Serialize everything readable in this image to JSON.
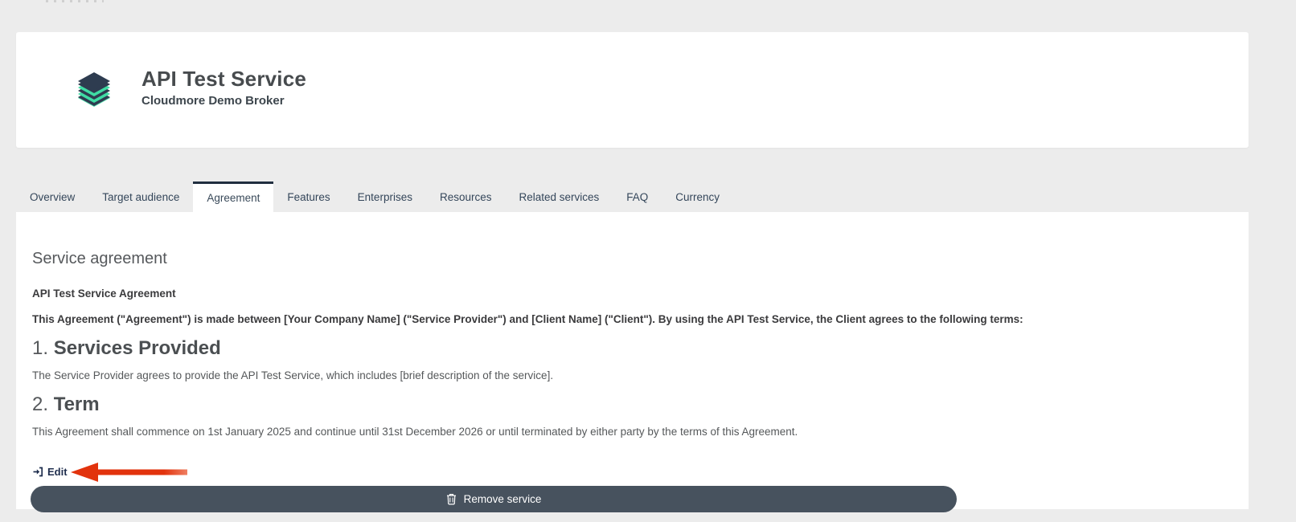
{
  "header": {
    "title": "API Test Service",
    "subtitle": "Cloudmore Demo Broker",
    "icon": "layers-stack-icon"
  },
  "tabs": [
    {
      "label": "Overview",
      "active": false
    },
    {
      "label": "Target audience",
      "active": false
    },
    {
      "label": "Agreement",
      "active": true
    },
    {
      "label": "Features",
      "active": false
    },
    {
      "label": "Enterprises",
      "active": false
    },
    {
      "label": "Resources",
      "active": false
    },
    {
      "label": "Related services",
      "active": false
    },
    {
      "label": "FAQ",
      "active": false
    },
    {
      "label": "Currency",
      "active": false
    }
  ],
  "content": {
    "section_title": "Service agreement",
    "agreement_title": "API Test Service Agreement",
    "intro": "This Agreement (\"Agreement\") is made between [Your Company Name] (\"Service Provider\") and [Client Name] (\"Client\"). By using the API Test Service, the Client agrees to the following terms:",
    "sections": [
      {
        "number": "1.",
        "heading": "Services Provided",
        "body": "The Service Provider agrees to provide the API Test Service, which includes [brief description of the service]."
      },
      {
        "number": "2.",
        "heading": "Term",
        "body": "This Agreement shall commence on 1st January 2025 and continue until 31st December 2026 or until terminated by either party by the terms of this Agreement."
      }
    ],
    "edit_label": "Edit"
  },
  "actions": {
    "remove_label": "Remove service"
  },
  "annotation": {
    "shape": "red-arrow-pointing-left-at-edit-link",
    "color": "#e2330d"
  },
  "colors": {
    "page_bg": "#ececec",
    "card_bg": "#ffffff",
    "active_tab_border": "#202e3f",
    "button_bg": "#47525e",
    "icon_navy": "#2e3c50",
    "icon_mint": "#3fdca4",
    "edit_link": "#1f2e4e"
  }
}
